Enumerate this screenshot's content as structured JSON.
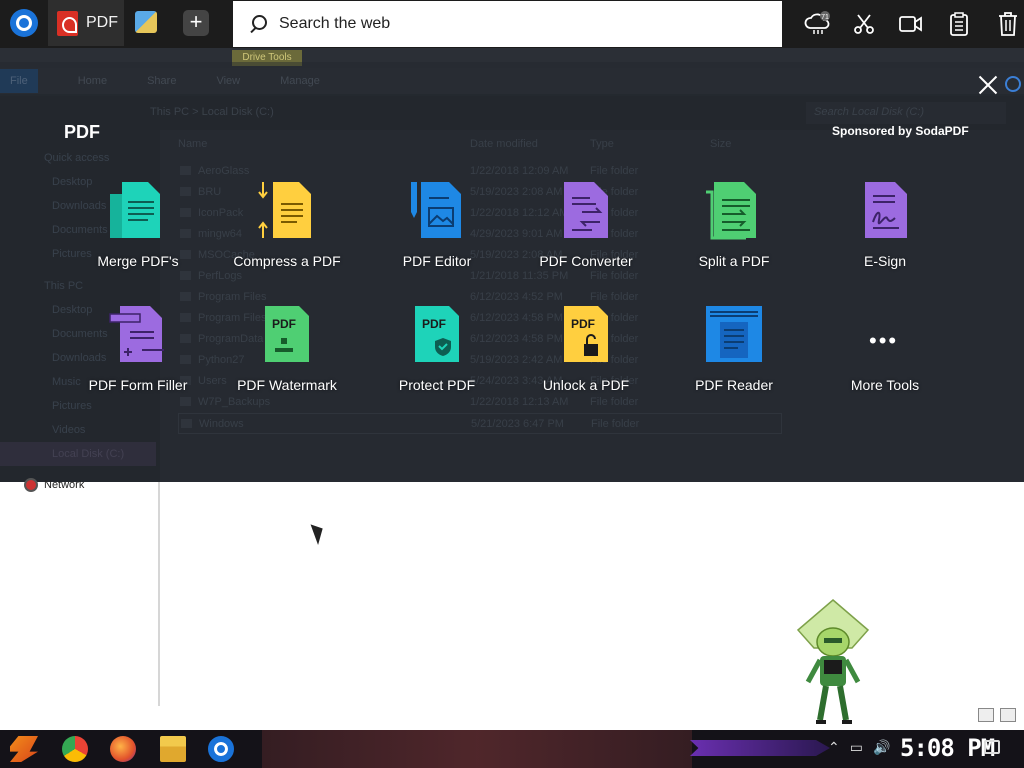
{
  "browser": {
    "tab_label": "PDF",
    "search_placeholder": "Search the web",
    "weather_badge": "71"
  },
  "explorer": {
    "drive_tools": "Drive Tools",
    "ribbon": [
      "File",
      "Home",
      "Share",
      "View",
      "Manage"
    ],
    "path": "This PC  >  Local Disk (C:)",
    "search_placeholder": "Search Local Disk (C:)",
    "columns": {
      "name": "Name",
      "date": "Date modified",
      "type": "Type",
      "size": "Size"
    },
    "nav": {
      "quick_access": "Quick access",
      "desktop": "Desktop",
      "downloads": "Downloads",
      "documents": "Documents",
      "pictures": "Pictures",
      "this_pc": "This PC",
      "pc_desktop": "Desktop",
      "pc_documents": "Documents",
      "pc_downloads": "Downloads",
      "music": "Music",
      "pc_pictures": "Pictures",
      "videos": "Videos",
      "local_disk": "Local Disk (C:)",
      "network": "Network"
    },
    "rows": [
      {
        "name": "AeroGlass",
        "date": "1/22/2018 12:09 AM",
        "type": "File folder"
      },
      {
        "name": "BRU",
        "date": "5/19/2023 2:08 AM",
        "type": "File folder"
      },
      {
        "name": "IconPack",
        "date": "1/22/2018 12:12 AM",
        "type": "File folder"
      },
      {
        "name": "mingw64",
        "date": "4/29/2023 9:01 AM",
        "type": "File folder"
      },
      {
        "name": "MSOCache",
        "date": "5/19/2023 2:08 AM",
        "type": "File folder"
      },
      {
        "name": "PerfLogs",
        "date": "1/21/2018 11:35 PM",
        "type": "File folder"
      },
      {
        "name": "Program Files",
        "date": "6/12/2023 4:52 PM",
        "type": "File folder"
      },
      {
        "name": "Program Files",
        "date": "6/12/2023 4:58 PM",
        "type": "File folder"
      },
      {
        "name": "ProgramData",
        "date": "6/12/2023 4:58 PM",
        "type": "File folder"
      },
      {
        "name": "Python27",
        "date": "5/19/2023 2:42 AM",
        "type": "File folder"
      },
      {
        "name": "Users",
        "date": "5/24/2023 3:43 AM",
        "type": "File folder"
      },
      {
        "name": "W7P_Backups",
        "date": "1/22/2018 12:13 AM",
        "type": "File folder"
      },
      {
        "name": "Windows",
        "date": "5/21/2023 6:47 PM",
        "type": "File folder"
      }
    ]
  },
  "overlay": {
    "title": "PDF",
    "sponsor": "Sponsored by SodaPDF",
    "tools": [
      {
        "label": "Merge PDF's",
        "icon": "merge-pdf-icon",
        "color": "#1ed3b9"
      },
      {
        "label": "Compress a PDF",
        "icon": "compress-pdf-icon",
        "color": "#ffcf3f"
      },
      {
        "label": "PDF Editor",
        "icon": "pdf-editor-icon",
        "color": "#1e88e5"
      },
      {
        "label": "PDF Converter",
        "icon": "pdf-converter-icon",
        "color": "#9c6be0"
      },
      {
        "label": "Split a PDF",
        "icon": "split-pdf-icon",
        "color": "#4fcf73"
      },
      {
        "label": "E-Sign",
        "icon": "e-sign-icon",
        "color": "#9c6be0"
      },
      {
        "label": "PDF Form Filler",
        "icon": "form-filler-icon",
        "color": "#9c6be0"
      },
      {
        "label": "PDF Watermark",
        "icon": "watermark-icon",
        "color": "#4fcf73"
      },
      {
        "label": "Protect PDF",
        "icon": "protect-pdf-icon",
        "color": "#1ed3b9"
      },
      {
        "label": "Unlock a PDF",
        "icon": "unlock-pdf-icon",
        "color": "#ffcf3f"
      },
      {
        "label": "PDF Reader",
        "icon": "pdf-reader-icon",
        "color": "#1e88e5"
      },
      {
        "label": "More Tools",
        "icon": "more-tools-icon",
        "color": "#ffffff"
      }
    ]
  },
  "taskbar": {
    "clock": "5:08 PM"
  }
}
